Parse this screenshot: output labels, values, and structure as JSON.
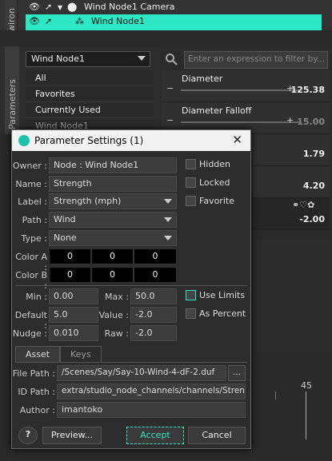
{
  "scene": {
    "vertical_tab": "wiron",
    "row1_label": "Wind Node1 Camera",
    "row2_label": "Wind Node1"
  },
  "left_panel": {
    "vertical_tab": "Parameters",
    "dropdown_value": "Wind Node1",
    "items": [
      "All",
      "Favorites",
      "Currently Used",
      "Wind Node1"
    ]
  },
  "right_panel": {
    "filter_placeholder": "Enter an expression to filter by...",
    "props": [
      {
        "label": "Diameter",
        "value": "125.38"
      },
      {
        "label": "Diameter Falloff",
        "value": "15.00"
      },
      {
        "label": "",
        "value": "1.79"
      },
      {
        "label": "",
        "value": "4.20"
      },
      {
        "label": "",
        "value": "-2.00"
      }
    ]
  },
  "timeline": {
    "tick_label": "45"
  },
  "dialog": {
    "title": "Parameter Settings (1)",
    "close_glyph": "✕",
    "owner_label": "Owner :",
    "owner_value": "Node : Wind Node1",
    "name_label": "Name :",
    "name_value": "Strength",
    "label_label": "Label :",
    "label_value": "Strength (mph)",
    "path_label": "Path :",
    "path_value": "Wind",
    "type_label": "Type :",
    "type_value": "None",
    "colora_label": "Color A :",
    "colora_values": [
      "0",
      "0",
      "0"
    ],
    "colorb_label": "Color B :",
    "colorb_values": [
      "0",
      "0",
      "0"
    ],
    "hidden_label": "Hidden",
    "locked_label": "Locked",
    "favorite_label": "Favorite",
    "min_label": "Min :",
    "min_value": "0.00",
    "max_label": "Max :",
    "max_value": "50.0",
    "default_label": "Default :",
    "default_value": "5.0",
    "value_label": "Value :",
    "value_value": "-2.0",
    "nudge_label": "Nudge :",
    "nudge_value": "0.010",
    "raw_label": "Raw :",
    "raw_value": "-2.0",
    "use_limits_label": "Use Limits",
    "as_percent_label": "As Percent",
    "tab_asset": "Asset",
    "tab_keys": "Keys",
    "filepath_label": "File Path :",
    "filepath_value": "/Scenes/Say/Say-10-Wind-4-dF-2.duf",
    "browse_label": "...",
    "idpath_label": "ID Path :",
    "idpath_value": "extra/studio_node_channels/channels/Strength",
    "author_label": "Author :",
    "author_value": "imantoko",
    "help_label": "?",
    "preview_label": "Preview...",
    "accept_label": "Accept",
    "cancel_label": "Cancel"
  },
  "colors": {
    "accent": "#2de8c4",
    "dialog_bg": "#2d2d2d"
  }
}
